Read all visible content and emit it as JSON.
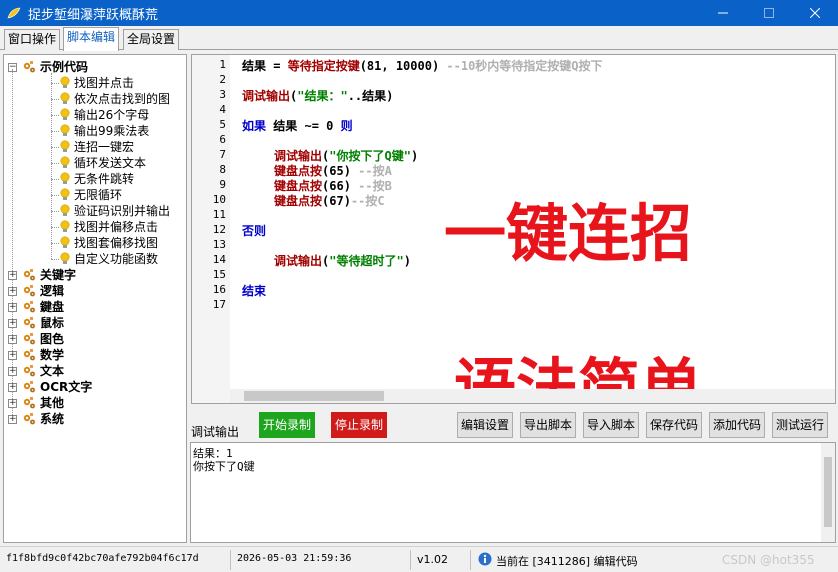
{
  "window": {
    "title": "捉步堑细瀑萍跃概酥荒",
    "minimize_icon": "minimize-icon",
    "maximize_icon": "maximize-icon",
    "close_icon": "close-icon"
  },
  "tabs": [
    {
      "label": "窗口操作"
    },
    {
      "label": "脚本编辑"
    },
    {
      "label": "全局设置"
    }
  ],
  "tree": {
    "root": "示例代码",
    "children": [
      "找图并点击",
      "依次点击找到的图",
      "输出26个字母",
      "输出99乘法表",
      "连招一键宏",
      "循环发送文本",
      "无条件跳转",
      "无限循环",
      "验证码识别并输出",
      "找图并偏移点击",
      "找图套偏移找图",
      "自定义功能函数"
    ],
    "categories": [
      "关键字",
      "逻辑",
      "鍵盘",
      "鼠标",
      "图色",
      "数学",
      "文本",
      "OCR文字",
      "其他",
      "系统"
    ],
    "expanded_glyph": "−",
    "collapsed_glyph": "+"
  },
  "editor": {
    "line_numbers": [
      "1",
      "2",
      "3",
      "4",
      "5",
      "6",
      "7",
      "8",
      "9",
      "10",
      "11",
      "12",
      "13",
      "14",
      "15",
      "16",
      "17"
    ],
    "code": {
      "l1_a": "结果 = ",
      "l1_b": "等待指定按键",
      "l1_c": "(81, 10000) ",
      "l1_d": "--10秒内等待指定按键Q按下",
      "l3_a": "调试输出",
      "l3_b": "(",
      "l3_c": "\"结果：\"",
      "l3_d": "..结果)",
      "l5_a": "如果",
      "l5_b": " 结果 ~= 0 ",
      "l5_c": "则",
      "l7_a": "调试输出",
      "l7_b": "(",
      "l7_c": "\"你按下了Q键\"",
      "l7_d": ")",
      "l8_a": "键盘点按",
      "l8_b": "(65) ",
      "l8_c": "--按A",
      "l9_a": "键盘点按",
      "l9_b": "(66) ",
      "l9_c": "--按B",
      "l10_a": "键盘点按",
      "l10_b": "(67)",
      "l10_c": "--按C",
      "l12_a": "否则",
      "l14_a": "调试输出",
      "l14_b": "(",
      "l14_c": "\"等待超时了\"",
      "l14_d": ")",
      "l16_a": "结束"
    },
    "overlay_1": "一键连招",
    "overlay_2": "语法简单"
  },
  "debug": {
    "label": "调试输出",
    "buttons": {
      "start_record": "开始录制",
      "stop_record": "停止录制",
      "edit_settings": "编辑设置",
      "export_script": "导出脚本",
      "import_script": "导入脚本",
      "save_code": "保存代码",
      "add_code": "添加代码",
      "test_run": "测试运行"
    },
    "output_lines": [
      "结果：1",
      "你按下了Q键"
    ]
  },
  "status": {
    "hash": "f1f8bfd9c0f42bc70afe792b04f6c17d",
    "datetime": "2026-05-03 21:59:36",
    "version": "v1.02",
    "current": "当前在 [3411286] 编辑代码",
    "watermark": "CSDN @hot355"
  },
  "colors": {
    "titlebar": "#0a62c8",
    "keyword": "#0000cc",
    "function": "#a00000",
    "string": "#008000",
    "comment": "#b0b0b0",
    "overlay_red": "#e8141c",
    "btn_green": "#1ea51e",
    "btn_red": "#d01b1b"
  }
}
